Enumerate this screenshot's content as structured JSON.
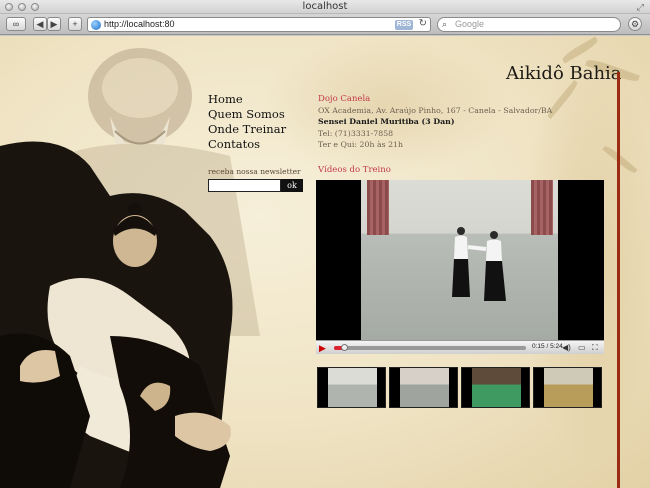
{
  "browser": {
    "window_title": "localhost",
    "url": "http://localhost:80",
    "rss_label": "RSS",
    "search_placeholder": "Google"
  },
  "site": {
    "brand": "Aikidô Bahia",
    "nav": [
      "Home",
      "Quem Somos",
      "Onde Treinar",
      "Contatos"
    ],
    "newsletter": {
      "label": "receba nossa newsletter",
      "button": "ok",
      "value": ""
    },
    "dojo": {
      "heading": "Dojo Canela",
      "address": "OX Academia, Av. Araújo Pinho, 167 - Canela - Salvador/BA",
      "sensei": "Sensei Daniel Muritiba (3 Dan)",
      "phone": "Tel: (71)3331-7858",
      "schedule": "Ter e Qui: 20h às 21h"
    },
    "videos_title": "Vídeos do Treino",
    "player": {
      "time": "0:15 / 5:24",
      "progress": 0.05
    },
    "colors": {
      "accent": "#c23a4a",
      "divider": "#9b2b13",
      "text": "#1c1a16"
    }
  }
}
